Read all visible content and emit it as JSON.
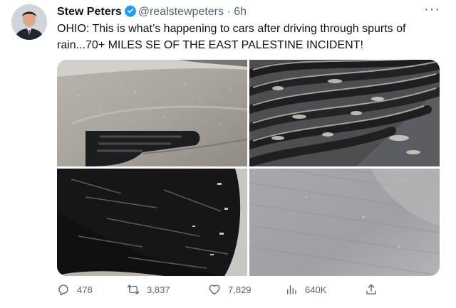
{
  "tweet": {
    "display_name": "Stew Peters",
    "handle": "@realstewpeters",
    "separator": "·",
    "time": "6h",
    "more_label": "···",
    "text": "OHIO: This is what’s happening to cars after driving through spurts of rain...70+ MILES SE OF THE EAST PALESTINE INCIDENT!"
  },
  "actions": {
    "replies": "478",
    "retweets": "3,837",
    "likes": "7,829",
    "views": "640K"
  },
  "colors": {
    "verified_blue": "#1d9bf0",
    "secondary_text": "#536471",
    "primary_text": "#0f1419"
  },
  "icons": {
    "verified": "verified-badge-icon",
    "more": "more-dots-icon",
    "reply": "reply-icon",
    "retweet": "retweet-icon",
    "like": "heart-icon",
    "views": "views-chart-icon",
    "share": "share-icon"
  }
}
